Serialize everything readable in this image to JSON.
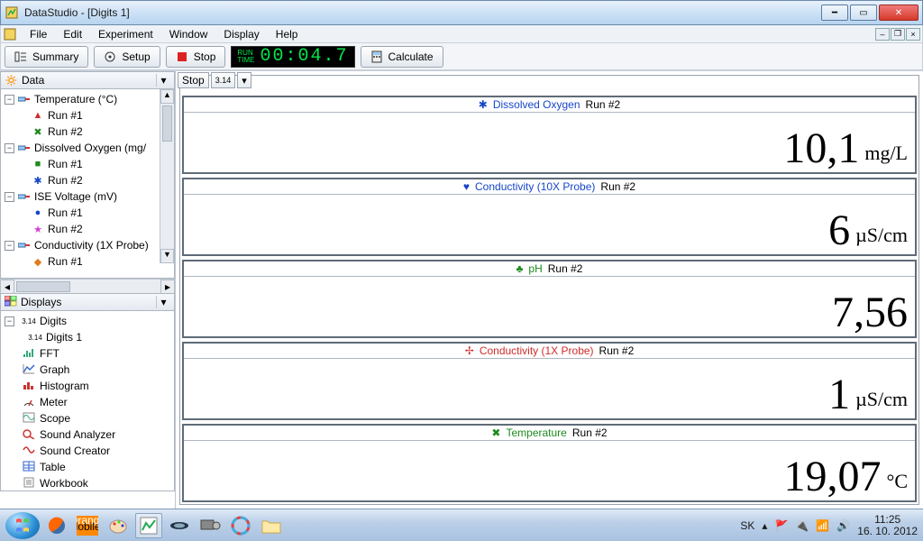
{
  "window": {
    "title": "DataStudio - [Digits 1]"
  },
  "menu": {
    "items": [
      "File",
      "Edit",
      "Experiment",
      "Window",
      "Display",
      "Help"
    ]
  },
  "toolbar": {
    "summary": "Summary",
    "setup": "Setup",
    "stop": "Stop",
    "calculate": "Calculate",
    "timer": {
      "label1": "RUN",
      "label2": "TIME",
      "value": "00:04.7"
    }
  },
  "mini_toolbar": {
    "stop": "Stop",
    "pi": "3.14"
  },
  "sidebar": {
    "data_header": "Data",
    "tree": [
      {
        "label": "Temperature (°C)",
        "runs": [
          {
            "marker": "▲",
            "color": "#d12b2b",
            "label": "Run #1"
          },
          {
            "marker": "✖",
            "color": "#1e8a1e",
            "label": "Run #2"
          }
        ]
      },
      {
        "label": "Dissolved Oxygen (mg/L)",
        "label_vis": "Dissolved Oxygen (mg/",
        "runs": [
          {
            "marker": "■",
            "color": "#1e8a1e",
            "label": "Run #1"
          },
          {
            "marker": "✱",
            "color": "#1646c8",
            "label": "Run #2"
          }
        ]
      },
      {
        "label": "ISE Voltage  (mV)",
        "runs": [
          {
            "marker": "●",
            "color": "#1646c8",
            "label": "Run #1"
          },
          {
            "marker": "★",
            "color": "#d63bd6",
            "label": "Run #2"
          }
        ]
      },
      {
        "label": "Conductivity (1X Probe)",
        "runs": [
          {
            "marker": "◆",
            "color": "#e07a1c",
            "label": "Run #1"
          }
        ]
      }
    ],
    "displays_header": "Displays",
    "displays": [
      {
        "label": "Digits",
        "icon": "3.14",
        "children": [
          {
            "label": "Digits 1",
            "icon": "3.14"
          }
        ]
      },
      {
        "label": "FFT",
        "icon": "fft"
      },
      {
        "label": "Graph",
        "icon": "graph"
      },
      {
        "label": "Histogram",
        "icon": "histo"
      },
      {
        "label": "Meter",
        "icon": "meter"
      },
      {
        "label": "Scope",
        "icon": "scope"
      },
      {
        "label": "Sound Analyzer",
        "icon": "sound-an"
      },
      {
        "label": "Sound Creator",
        "icon": "sound-cr"
      },
      {
        "label": "Table",
        "icon": "table"
      },
      {
        "label": "Workbook",
        "icon": "workbook"
      }
    ]
  },
  "cards": [
    {
      "symbol": "✱",
      "sym_color": "#1646c8",
      "name": "Dissolved Oxygen",
      "name_color": "#1646c8",
      "run": "Run #2",
      "value": "10,1",
      "unit": "mg/L"
    },
    {
      "symbol": "♥",
      "sym_color": "#1646c8",
      "name": "Conductivity (10X Probe)",
      "name_color": "#1646c8",
      "run": "Run #2",
      "value": "6",
      "unit": "µS/cm"
    },
    {
      "symbol": "♣",
      "sym_color": "#1e8a1e",
      "name": "pH",
      "name_color": "#1e8a1e",
      "run": "Run #2",
      "value": "7,56",
      "unit": ""
    },
    {
      "symbol": "✢",
      "sym_color": "#d12b2b",
      "name": "Conductivity (1X Probe)",
      "name_color": "#d12b2b",
      "run": "Run #2",
      "value": "1",
      "unit": "µS/cm"
    },
    {
      "symbol": "✖",
      "sym_color": "#1e8a1e",
      "name": "Temperature",
      "name_color": "#1e8a1e",
      "run": "Run #2",
      "value": "19,07",
      "unit": "°C"
    }
  ],
  "taskbar": {
    "lang": "SK",
    "time": "11:25",
    "date": "16. 10. 2012"
  }
}
